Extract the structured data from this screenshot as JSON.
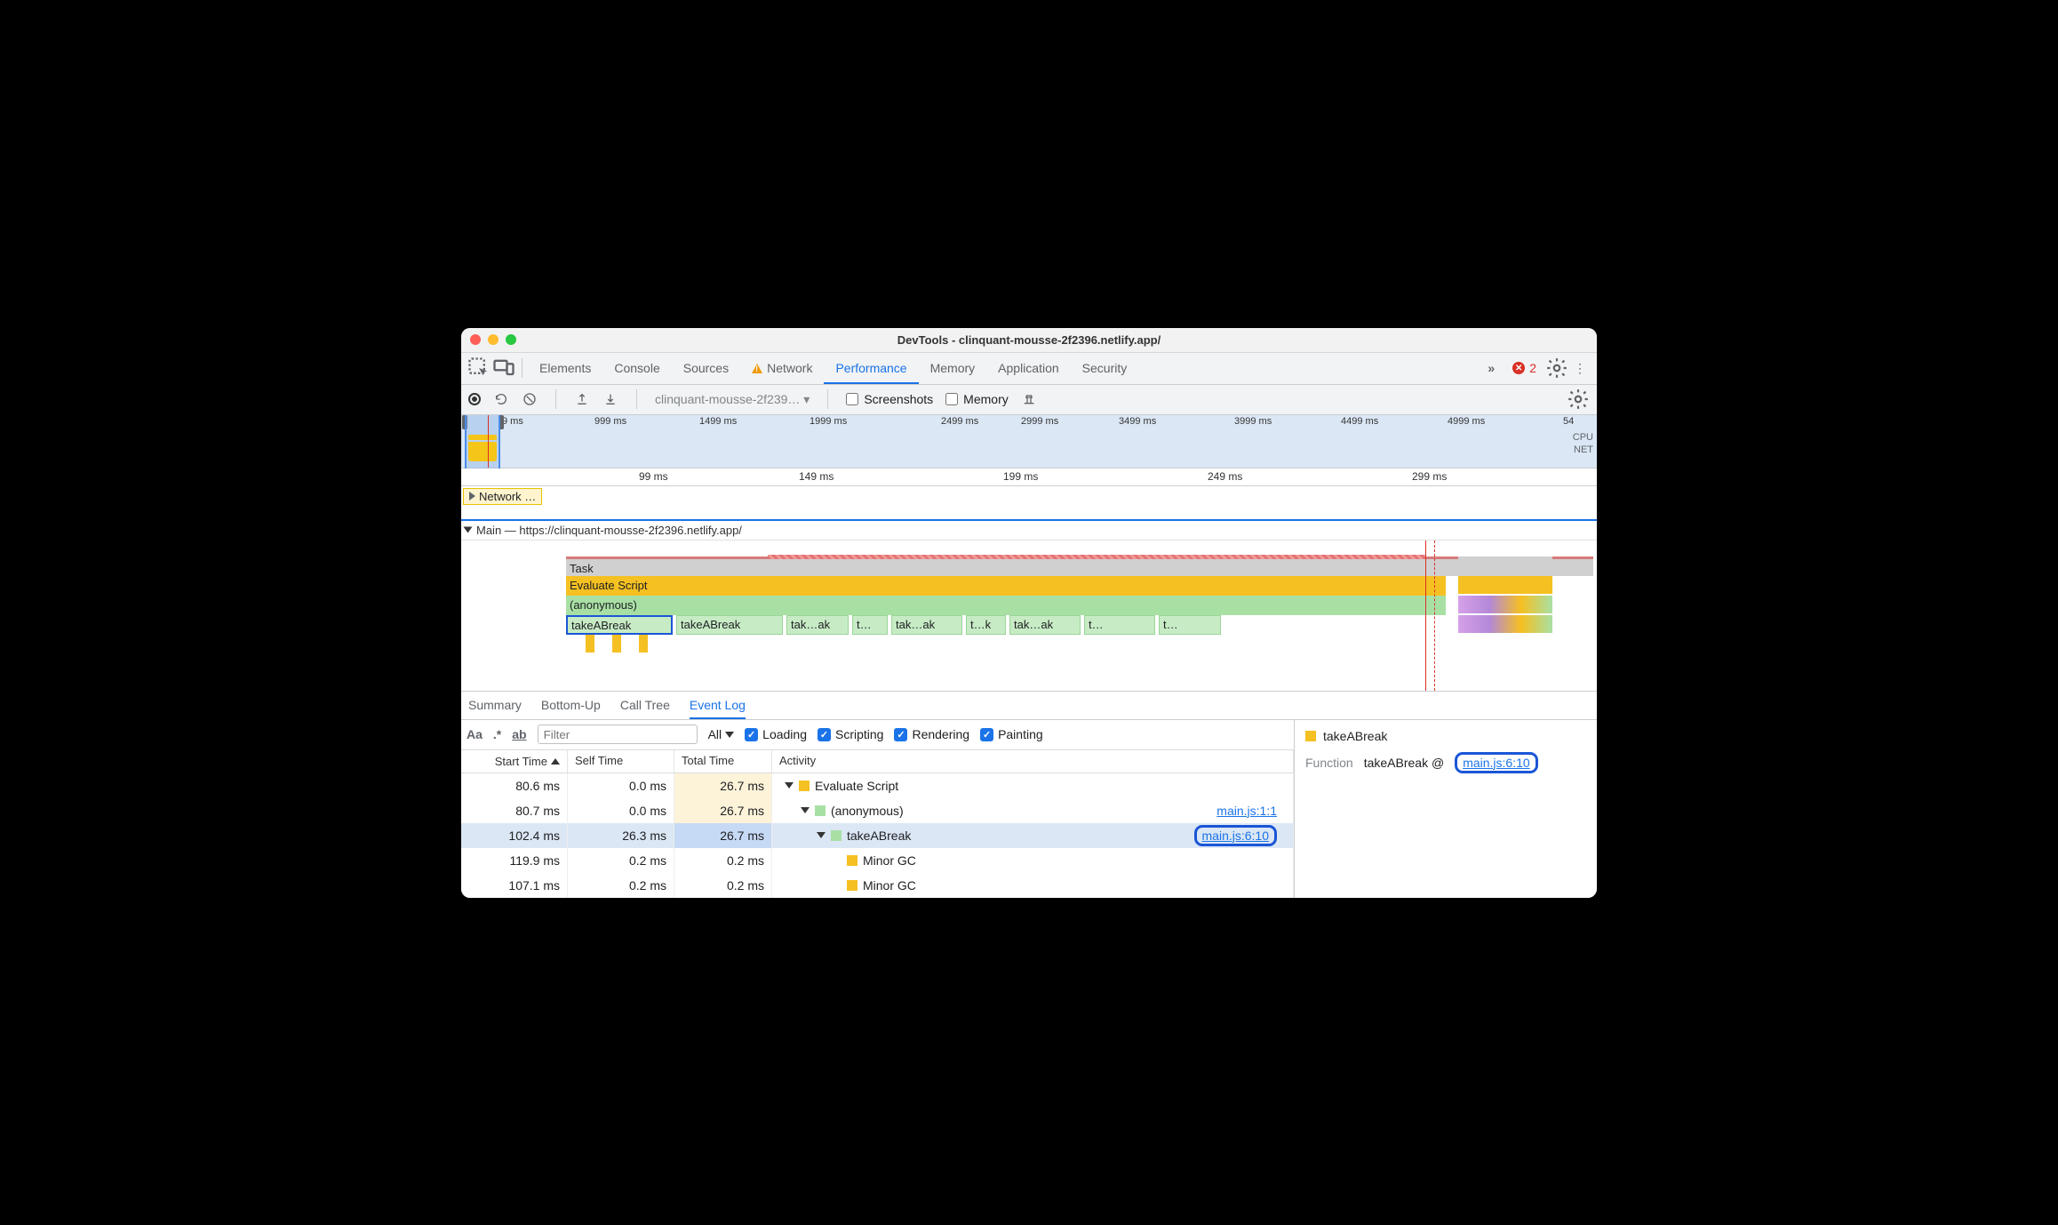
{
  "window": {
    "title": "DevTools - clinquant-mousse-2f2396.netlify.app/"
  },
  "tabs": {
    "elements": "Elements",
    "console": "Console",
    "sources": "Sources",
    "network": "Network",
    "performance": "Performance",
    "memory": "Memory",
    "application": "Application",
    "security": "Security",
    "more": "»",
    "error_count": "2"
  },
  "toolbar": {
    "profile_name": "clinquant-mousse-2f239… ▾",
    "screenshots": "Screenshots",
    "memory": "Memory"
  },
  "overview": {
    "ticks": [
      "9 ms",
      "999 ms",
      "1499 ms",
      "1999 ms",
      "2499 ms",
      "2999 ms",
      "3499 ms",
      "3999 ms",
      "4499 ms",
      "4999 ms",
      "54"
    ],
    "labels": {
      "cpu": "CPU",
      "net": "NET"
    }
  },
  "ruler": {
    "ticks": [
      "99 ms",
      "149 ms",
      "199 ms",
      "249 ms",
      "299 ms"
    ]
  },
  "network_track": "Network …",
  "main_track": "Main — https://clinquant-mousse-2f2396.netlify.app/",
  "flame": {
    "task": "Task",
    "evaluate": "Evaluate Script",
    "anonymous": "(anonymous)",
    "calls": [
      "takeABreak",
      "takeABreak",
      "tak…ak",
      "t…",
      "tak…ak",
      "t…k",
      "tak…ak",
      "t…",
      "t…"
    ]
  },
  "details_tabs": {
    "summary": "Summary",
    "bottom_up": "Bottom-Up",
    "call_tree": "Call Tree",
    "event_log": "Event Log"
  },
  "filterbar": {
    "aa": "Aa",
    "regex": ".*",
    "ab": "ab",
    "filter_placeholder": "Filter",
    "level": "All",
    "loading": "Loading",
    "scripting": "Scripting",
    "rendering": "Rendering",
    "painting": "Painting"
  },
  "eventlog": {
    "headers": {
      "start": "Start Time",
      "self": "Self Time",
      "total": "Total Time",
      "activity": "Activity"
    },
    "rows": [
      {
        "start": "80.6 ms",
        "self": "0.0 ms",
        "total": "26.7 ms",
        "total_class": "warm",
        "indent": 0,
        "expander": true,
        "color": "y",
        "activity": "Evaluate Script",
        "link": ""
      },
      {
        "start": "80.7 ms",
        "self": "0.0 ms",
        "total": "26.7 ms",
        "total_class": "warm",
        "indent": 1,
        "expander": true,
        "color": "g",
        "activity": "(anonymous)",
        "link": "main.js:1:1"
      },
      {
        "start": "102.4 ms",
        "self": "26.3 ms",
        "total": "26.7 ms",
        "total_class": "hot",
        "indent": 2,
        "expander": true,
        "color": "g",
        "activity": "takeABreak",
        "link": "main.js:6:10",
        "selected": true,
        "pill": true
      },
      {
        "start": "119.9 ms",
        "self": "0.2 ms",
        "total": "0.2 ms",
        "total_class": "",
        "indent": 3,
        "expander": false,
        "color": "y",
        "activity": "Minor GC",
        "link": ""
      },
      {
        "start": "107.1 ms",
        "self": "0.2 ms",
        "total": "0.2 ms",
        "total_class": "",
        "indent": 3,
        "expander": false,
        "color": "y",
        "activity": "Minor GC",
        "link": ""
      }
    ]
  },
  "sidepane": {
    "title": "takeABreak",
    "label": "Function",
    "func": "takeABreak @",
    "link": "main.js:6:10"
  }
}
